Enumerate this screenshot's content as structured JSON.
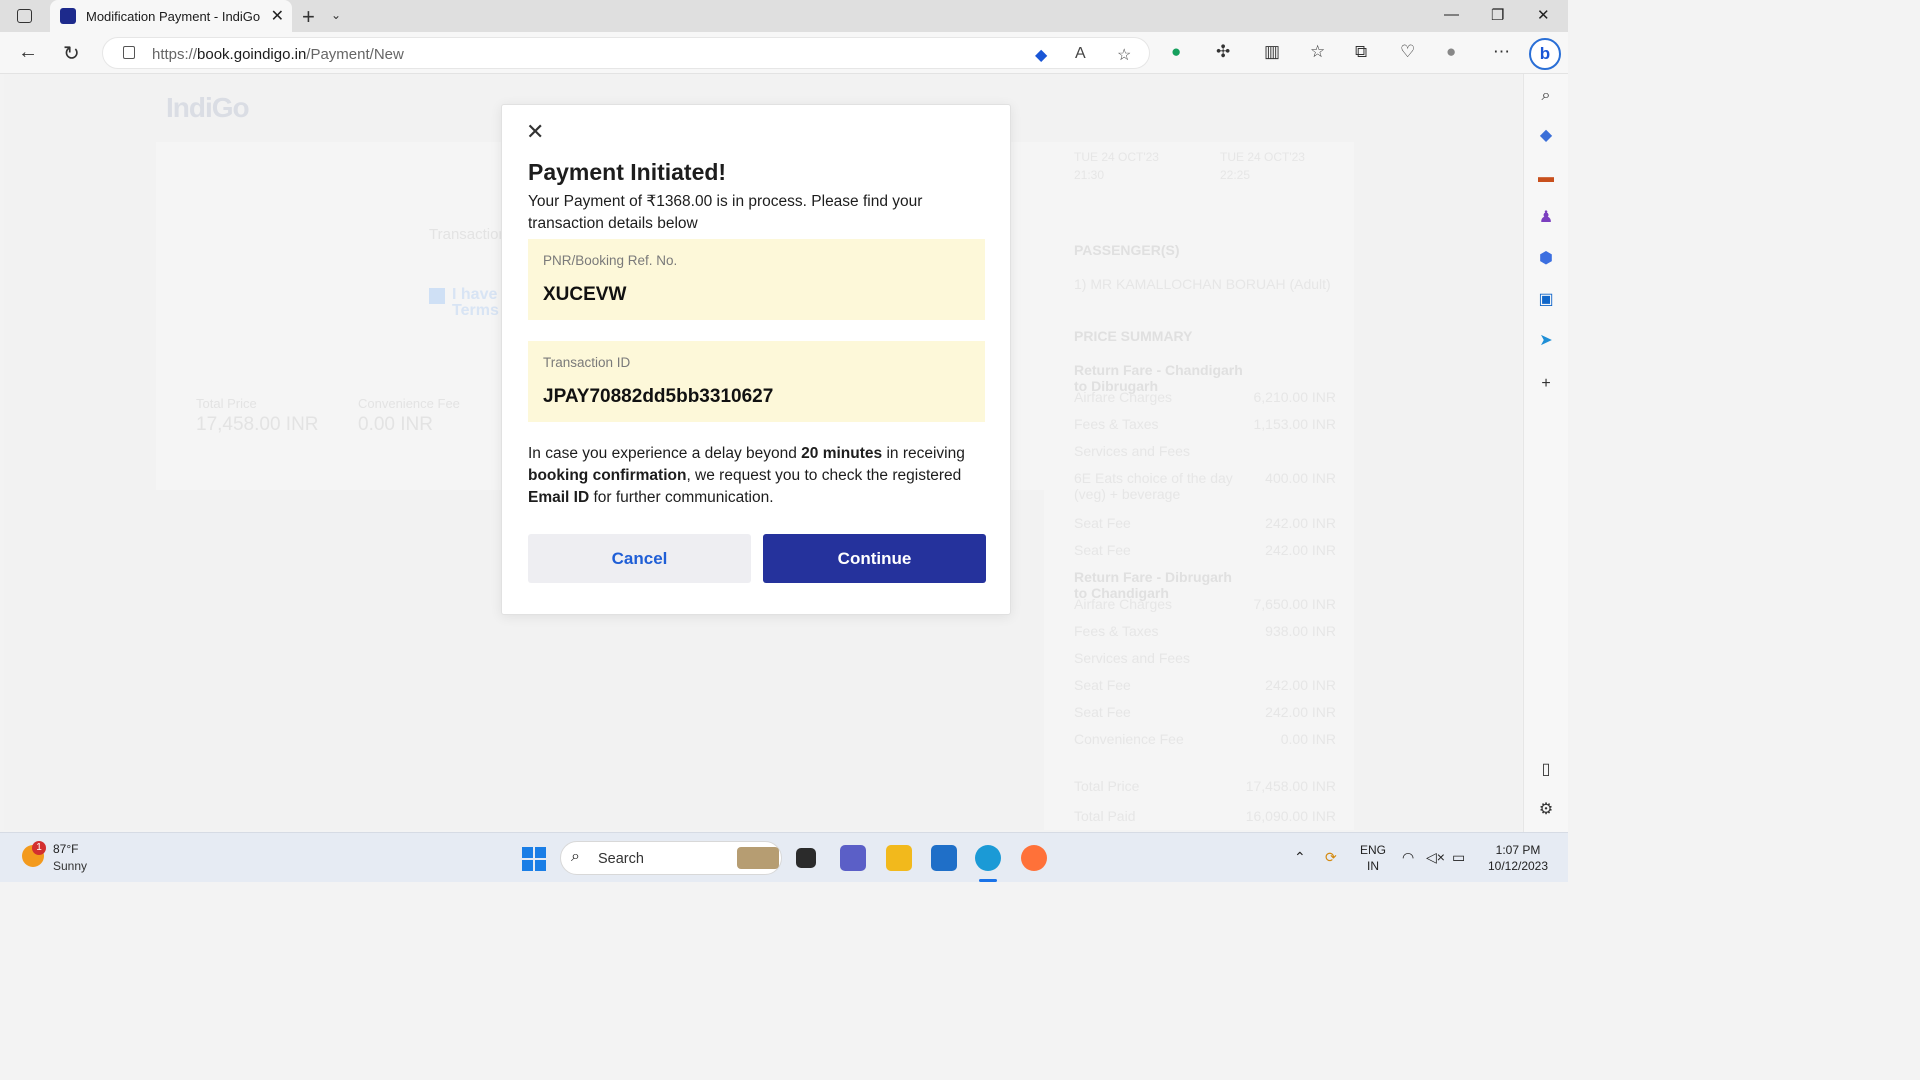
{
  "browser": {
    "tab_title": "Modification Payment - IndiGo",
    "url_prefix": "https://",
    "url_domain": "book.goindigo.in",
    "url_path": "/Payment/New"
  },
  "background": {
    "logo": "IndiGo",
    "transaction_text": "Transaction",
    "checkbox_text": "I have",
    "terms_text": "Terms",
    "total_price_label": "Total Price",
    "total_price_value": "17,458.00 INR",
    "convenience_label": "Convenience Fee",
    "convenience_value": "0.00 INR",
    "flight_date_1": "TUE 24 OCT'23",
    "flight_time_1": "21:30",
    "flight_date_2": "TUE 24 OCT'23",
    "flight_time_2": "22:25",
    "passengers_heading": "PASSENGER(S)",
    "passenger_1": "1) MR KAMALLOCHAN BORUAH (Adult)",
    "price_summary_heading": "PRICE SUMMARY",
    "rows": [
      {
        "label": "Return Fare - Chandigarh to Dibrugarh",
        "amount": "",
        "bold": true
      },
      {
        "label": "Airfare Charges",
        "amount": "6,210.00 INR"
      },
      {
        "label": "Fees & Taxes",
        "amount": "1,153.00 INR"
      },
      {
        "label": "Services and Fees",
        "amount": ""
      },
      {
        "label": "6E Eats choice of the day (veg) + beverage",
        "amount": "400.00 INR"
      },
      {
        "label": "Seat Fee",
        "amount": "242.00 INR"
      },
      {
        "label": "Seat Fee",
        "amount": "242.00 INR"
      },
      {
        "label": "Return Fare - Dibrugarh to Chandigarh",
        "amount": "",
        "bold": true
      },
      {
        "label": "Airfare Charges",
        "amount": "7,650.00 INR"
      },
      {
        "label": "Fees & Taxes",
        "amount": "938.00 INR"
      },
      {
        "label": "Services and Fees",
        "amount": ""
      },
      {
        "label": "Seat Fee",
        "amount": "242.00 INR"
      },
      {
        "label": "Seat Fee",
        "amount": "242.00 INR"
      },
      {
        "label": "Convenience Fee",
        "amount": "0.00 INR"
      },
      {
        "label": "Total Price",
        "amount": "17,458.00 INR"
      },
      {
        "label": "Total Paid",
        "amount": "16,090.00 INR"
      }
    ]
  },
  "modal": {
    "title": "Payment Initiated!",
    "description": "Your Payment of ₹1368.00 is in process. Please find your transaction details below",
    "pnr_label": "PNR/Booking Ref. No.",
    "pnr_value": "XUCEVW",
    "txn_label": "Transaction ID",
    "txn_value": "JPAY70882dd5bb3310627",
    "notice_1": "In case you experience a delay beyond ",
    "notice_bold_1": "20 minutes",
    "notice_2": " in receiving ",
    "notice_bold_2": "booking confirmation",
    "notice_3": ", we request you to check the registered ",
    "notice_bold_3": "Email ID",
    "notice_4": " for further communication.",
    "cancel_label": "Cancel",
    "continue_label": "Continue"
  },
  "taskbar": {
    "weather_badge": "1",
    "temperature": "87°F",
    "condition": "Sunny",
    "search_label": "Search",
    "lang_1": "ENG",
    "lang_2": "IN",
    "time": "1:07 PM",
    "date": "10/12/2023"
  },
  "colors": {
    "brand_primary": "#25329c",
    "link_blue": "#1f5ed6",
    "info_box_bg": "#fdf8d9"
  }
}
